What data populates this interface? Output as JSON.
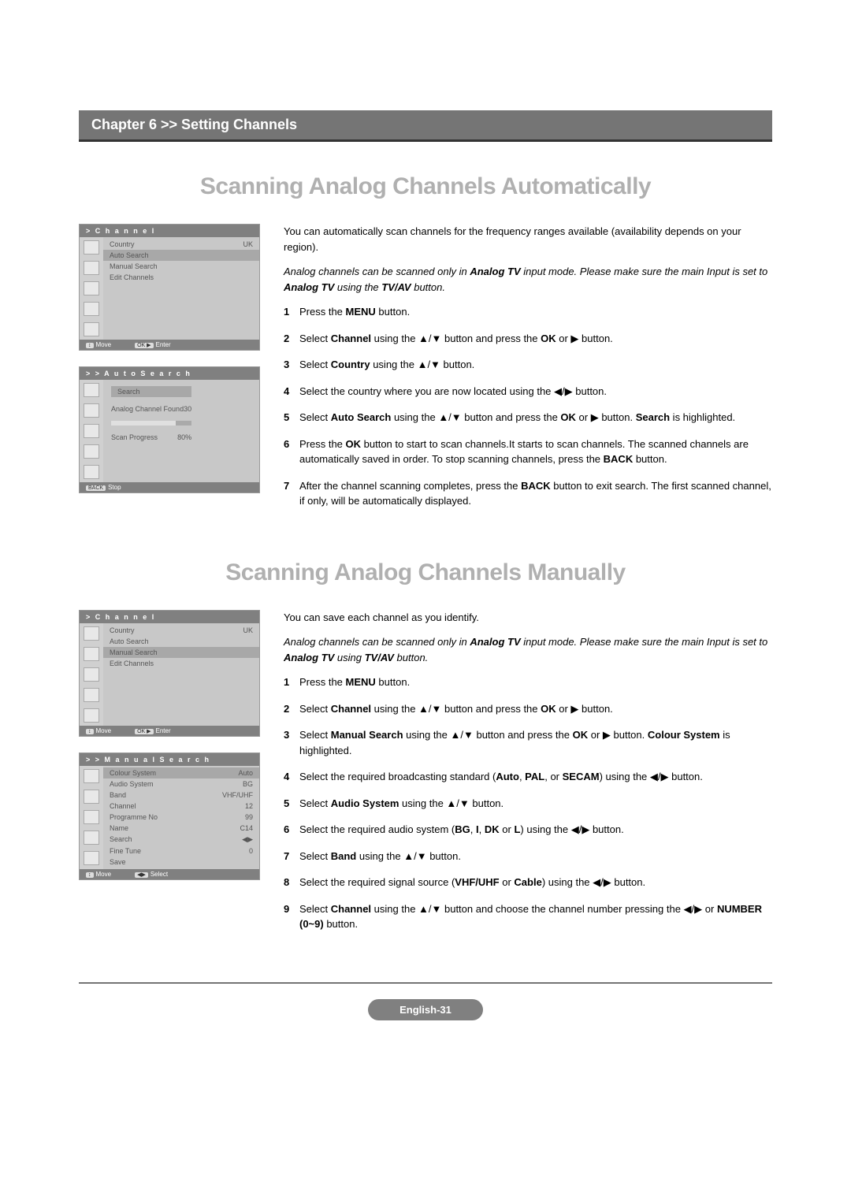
{
  "chapter": "Chapter 6 >> Setting Channels",
  "section1": {
    "title": "Scanning Analog Channels Automatically",
    "intro": "You can automatically scan channels for the frequency ranges available (availability depends on your region).",
    "note_pre": "Analog channels can be scanned only in ",
    "note_b1": "Analog TV",
    "note_mid": " input mode. Please make sure the main Input is set to ",
    "note_b2": "Analog TV",
    "note_post": " using the ",
    "note_b3": "TV/AV",
    "note_end": " button.",
    "steps": [
      {
        "n": "1",
        "pre": "Press the ",
        "b": "MENU",
        "post": " button."
      },
      {
        "n": "2",
        "pre": "Select ",
        "b": "Channel",
        "post": " using the ▲/▼ button and press the ",
        "b2": "OK",
        "post2": " or ▶ button."
      },
      {
        "n": "3",
        "pre": "Select ",
        "b": "Country",
        "post": " using the ▲/▼ button."
      },
      {
        "n": "4",
        "pre": "Select the country where you are now located using the ◀/▶ button.",
        "b": "",
        "post": ""
      },
      {
        "n": "5",
        "pre": "Select ",
        "b": "Auto Search",
        "post": " using the ▲/▼ button and press the ",
        "b2": "OK",
        "post2": " or ▶ button. ",
        "b3": "Search",
        "post3": " is highlighted."
      },
      {
        "n": "6",
        "pre": "Press the ",
        "b": "OK",
        "post": " button to start to scan channels.It starts to scan channels. The scanned channels are automatically saved in order. To stop scanning channels, press the ",
        "b2": "BACK",
        "post2": " button."
      },
      {
        "n": "7",
        "pre": "After the channel scanning completes, press the ",
        "b": "BACK",
        "post": " button to exit search. The first scanned channel, if only, will be automatically displayed."
      }
    ],
    "menu1": {
      "title": ">   C h a n n e l",
      "items": [
        {
          "label": "Country",
          "val": "UK",
          "hl": false
        },
        {
          "label": "Auto Search",
          "val": "",
          "hl": true
        },
        {
          "label": "Manual Search",
          "val": "",
          "hl": false
        },
        {
          "label": "Edit Channels",
          "val": "",
          "hl": false
        }
      ],
      "footer_left": "Move",
      "footer_right": "Enter",
      "footer_tag_l": "↕",
      "footer_tag_r": "OK ▶"
    },
    "menu2": {
      "title": "> >   A u t o   S e a r c h",
      "search_label": "Search",
      "found_label": "Analog Channel Found",
      "found_val": "30",
      "progress_label": "Scan Progress",
      "progress_val": "80%",
      "footer_tag": "BACK",
      "footer_left": "Stop"
    }
  },
  "section2": {
    "title": "Scanning Analog Channels Manually",
    "intro": "You can save each channel as you identify.",
    "note_pre": "Analog channels can be scanned only in ",
    "note_b1": "Analog TV",
    "note_mid": " input mode. Please make sure the main Input is set to ",
    "note_b2": "Analog TV",
    "note_post": " using ",
    "note_b3": "TV/AV",
    "note_end": " button.",
    "steps": [
      {
        "n": "1",
        "pre": "Press the ",
        "b": "MENU",
        "post": " button."
      },
      {
        "n": "2",
        "pre": "Select ",
        "b": "Channel",
        "post": " using the ▲/▼ button and press the ",
        "b2": "OK",
        "post2": " or ▶ button."
      },
      {
        "n": "3",
        "pre": "Select ",
        "b": "Manual Search",
        "post": " using the ▲/▼ button and press the ",
        "b2": "OK",
        "post2": " or ▶ button. ",
        "b3": "Colour System",
        "post3": " is highlighted."
      },
      {
        "n": "4",
        "pre": "Select the required broadcasting standard (",
        "b": "Auto",
        "post": ", ",
        "b2": "PAL",
        "post2": ", or ",
        "b3": "SECAM",
        "post3": ") using the ◀/▶ button."
      },
      {
        "n": "5",
        "pre": "Select ",
        "b": "Audio System",
        "post": " using the ▲/▼ button."
      },
      {
        "n": "6",
        "pre": "Select the required audio system (",
        "b": "BG",
        "post": ", ",
        "b2": "I",
        "post2": ", ",
        "b3": "DK",
        "post3": " or ",
        "b4": "L",
        "post4": ") using the ◀/▶ button."
      },
      {
        "n": "7",
        "pre": "Select ",
        "b": "Band",
        "post": " using the ▲/▼ button."
      },
      {
        "n": "8",
        "pre": "Select the required signal source (",
        "b": "VHF/UHF",
        "post": " or ",
        "b2": "Cable",
        "post2": ") using the ◀/▶ button."
      },
      {
        "n": "9",
        "pre": "Select ",
        "b": "Channel",
        "post": " using the ▲/▼ button and choose the channel number pressing the ◀/▶ or ",
        "b2": "NUMBER (0~9)",
        "post2": " button."
      }
    ],
    "menu1": {
      "title": ">   C h a n n e l",
      "items": [
        {
          "label": "Country",
          "val": "UK",
          "hl": false
        },
        {
          "label": "Auto Search",
          "val": "",
          "hl": false
        },
        {
          "label": "Manual Search",
          "val": "",
          "hl": true
        },
        {
          "label": "Edit Channels",
          "val": "",
          "hl": false
        }
      ],
      "footer_left": "Move",
      "footer_right": "Enter",
      "footer_tag_l": "↕",
      "footer_tag_r": "OK ▶"
    },
    "menu2": {
      "title": "> >   M a n u a l   S e a r c h",
      "items": [
        {
          "label": "Colour System",
          "val": "Auto",
          "hl": true
        },
        {
          "label": "Audio System",
          "val": "BG",
          "hl": false
        },
        {
          "label": "Band",
          "val": "VHF/UHF",
          "hl": false
        },
        {
          "label": "Channel",
          "val": "12",
          "hl": false
        },
        {
          "label": "Programme No",
          "val": "99",
          "hl": false
        },
        {
          "label": "Name",
          "val": "C14",
          "hl": false
        },
        {
          "label": "Search",
          "val": "◀▶",
          "hl": false
        },
        {
          "label": "Fine Tune",
          "val": "0",
          "hl": false
        },
        {
          "label": "Save",
          "val": "",
          "hl": false
        }
      ],
      "footer_left": "Move",
      "footer_right": "Select",
      "footer_tag_l": "↕",
      "footer_tag_r": "◀▶"
    }
  },
  "page_label": "English-31"
}
